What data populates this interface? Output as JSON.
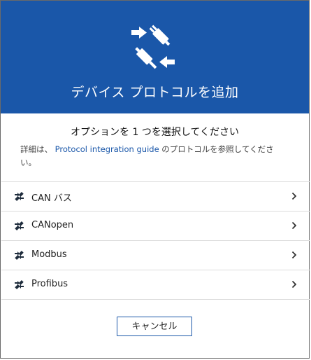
{
  "header": {
    "title": "デバイス プロトコルを追加",
    "icon": "plug-connect-icon",
    "background": "#1a57a9"
  },
  "subtitle": "オプションを 1 つを選択してください",
  "info": {
    "prefix": "詳細は、",
    "link": "Protocol integration guide",
    "suffix": "のプロトコルを参照してください。"
  },
  "options": [
    {
      "label": "CAN バス",
      "icon": "plug-icon"
    },
    {
      "label": "CANopen",
      "icon": "plug-icon"
    },
    {
      "label": "Modbus",
      "icon": "plug-icon"
    },
    {
      "label": "Profibus",
      "icon": "plug-icon"
    }
  ],
  "cancel_label": "キャンセル"
}
